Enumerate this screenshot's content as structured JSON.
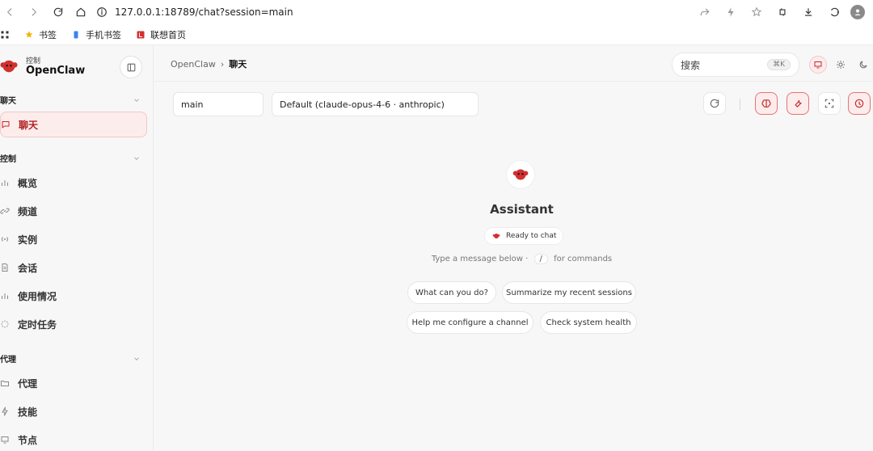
{
  "browser": {
    "url": "127.0.0.1:18789/chat?session=main",
    "bookmarks": [
      {
        "label": "书签"
      },
      {
        "label": "手机书签"
      },
      {
        "label": "联想首页"
      }
    ]
  },
  "app": {
    "brand_small": "控制",
    "brand_title": "OpenClaw"
  },
  "sidebar": {
    "sections": [
      {
        "title": "聊天"
      },
      {
        "title": "控制"
      },
      {
        "title": "代理"
      }
    ],
    "items": [
      {
        "label": "聊天"
      },
      {
        "label": "概览"
      },
      {
        "label": "频道"
      },
      {
        "label": "实例"
      },
      {
        "label": "会话"
      },
      {
        "label": "使用情况"
      },
      {
        "label": "定时任务"
      },
      {
        "label": "代理"
      },
      {
        "label": "技能"
      },
      {
        "label": "节点"
      }
    ]
  },
  "header": {
    "breadcrumb_root": "OpenClaw",
    "breadcrumb_sep": "›",
    "breadcrumb_current": "聊天",
    "search_placeholder": "搜索",
    "search_shortcut": "⌘K"
  },
  "chat": {
    "session_value": "main",
    "model_value": "Default (claude-opus-4-6 · anthropic)",
    "assistant_title": "Assistant",
    "ready_label": "Ready to chat",
    "hint_before": "Type a message below ·",
    "hint_slash": "/",
    "hint_after": "for commands",
    "suggestions": [
      {
        "label": "What can you do?"
      },
      {
        "label": "Summarize my recent sessions"
      },
      {
        "label": "Help me configure a channel"
      },
      {
        "label": "Check system health"
      }
    ]
  },
  "colors": {
    "accent": "#c62828",
    "accent_bg": "#fdecec"
  }
}
